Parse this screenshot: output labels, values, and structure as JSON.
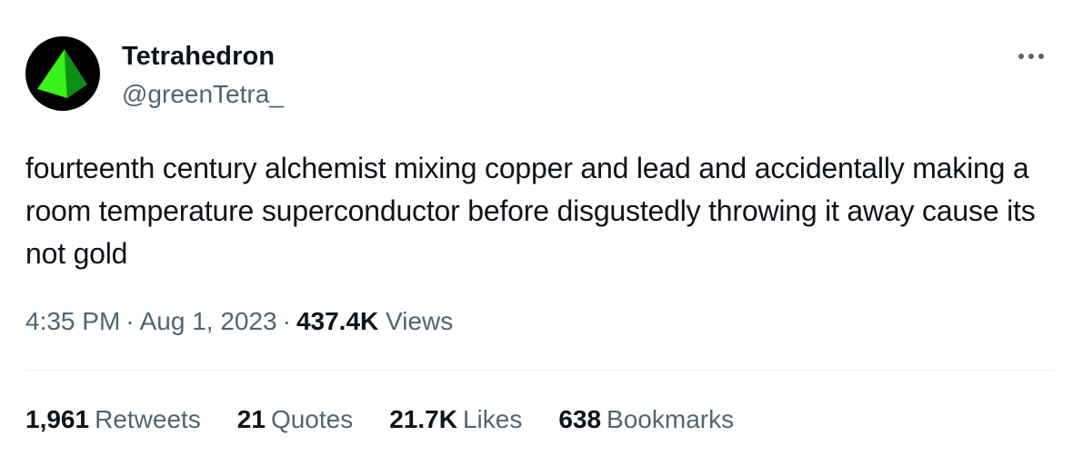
{
  "author": {
    "display_name": "Tetrahedron",
    "handle": "@greenTetra_",
    "avatar_icon": "green-tetrahedron-icon"
  },
  "tweet": {
    "text": "fourteenth century alchemist mixing copper and lead and accidentally making a room temperature superconductor before disgustedly throwing it away cause its not gold"
  },
  "meta": {
    "time": "4:35 PM",
    "separator": "·",
    "date": "Aug 1, 2023",
    "views_count": "437.4K",
    "views_label": "Views"
  },
  "stats": [
    {
      "count": "1,961",
      "label": "Retweets"
    },
    {
      "count": "21",
      "label": "Quotes"
    },
    {
      "count": "21.7K",
      "label": "Likes"
    },
    {
      "count": "638",
      "label": "Bookmarks"
    }
  ],
  "colors": {
    "text_primary": "#0f1419",
    "text_secondary": "#536471",
    "divider": "#eff3f4",
    "avatar_bg": "#000000",
    "tetra_light": "#39e41a",
    "tetra_dark": "#0b8a12"
  },
  "more_icon": "ellipsis-icon"
}
